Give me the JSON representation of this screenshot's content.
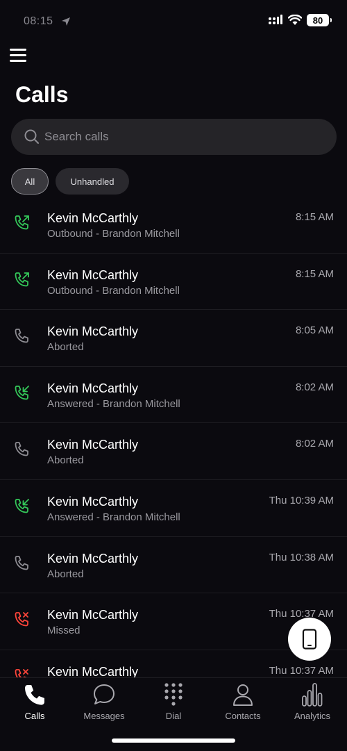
{
  "status": {
    "time": "08:15",
    "battery": "80"
  },
  "header": {
    "title": "Calls"
  },
  "search": {
    "placeholder": "Search calls"
  },
  "filters": [
    {
      "label": "All",
      "active": true
    },
    {
      "label": "Unhandled",
      "active": false
    }
  ],
  "calls": [
    {
      "name": "Kevin McCarthly",
      "detail": "Outbound - Brandon Mitchell",
      "time": "8:15 AM",
      "type": "outbound"
    },
    {
      "name": "Kevin McCarthly",
      "detail": "Outbound - Brandon Mitchell",
      "time": "8:15 AM",
      "type": "outbound"
    },
    {
      "name": "Kevin McCarthly",
      "detail": "Aborted",
      "time": "8:05 AM",
      "type": "aborted"
    },
    {
      "name": "Kevin McCarthly",
      "detail": "Answered - Brandon Mitchell",
      "time": "8:02 AM",
      "type": "answered"
    },
    {
      "name": "Kevin McCarthly",
      "detail": "Aborted",
      "time": "8:02 AM",
      "type": "aborted"
    },
    {
      "name": "Kevin McCarthly",
      "detail": "Answered - Brandon Mitchell",
      "time": "Thu 10:39 AM",
      "type": "answered"
    },
    {
      "name": "Kevin McCarthly",
      "detail": "Aborted",
      "time": "Thu 10:38 AM",
      "type": "aborted"
    },
    {
      "name": "Kevin McCarthly",
      "detail": "Missed",
      "time": "Thu 10:37 AM",
      "type": "missed"
    },
    {
      "name": "Kevin McCarthly",
      "detail": "",
      "time": "Thu 10:37 AM",
      "type": "missed"
    }
  ],
  "tabs": [
    {
      "label": "Calls",
      "icon": "phone-icon",
      "active": true
    },
    {
      "label": "Messages",
      "icon": "chat-bubble-icon",
      "active": false
    },
    {
      "label": "Dial",
      "icon": "dialpad-icon",
      "active": false
    },
    {
      "label": "Contacts",
      "icon": "person-icon",
      "active": false
    },
    {
      "label": "Analytics",
      "icon": "bar-chart-icon",
      "active": false
    }
  ],
  "colors": {
    "background": "#0b0a0f",
    "green": "#34c759",
    "red": "#ff453a",
    "gray_icon": "#8e8d93"
  }
}
